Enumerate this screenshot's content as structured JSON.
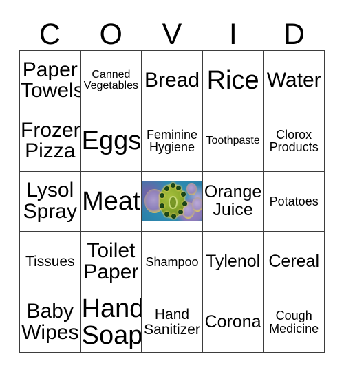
{
  "card": {
    "header_letters": [
      "C",
      "O",
      "V",
      "I",
      "D"
    ],
    "grid": {
      "rows": [
        [
          {
            "label": "Paper Towels",
            "size": "lg"
          },
          {
            "label": "Canned Vegetables",
            "size": "xxs"
          },
          {
            "label": "Bread",
            "size": "lg"
          },
          {
            "label": "Rice",
            "size": "xl"
          },
          {
            "label": "Water",
            "size": "lg"
          }
        ],
        [
          {
            "label": "Frozen Pizza",
            "size": "lg"
          },
          {
            "label": "Eggs",
            "size": "xl"
          },
          {
            "label": "Feminine Hygiene",
            "size": "xs"
          },
          {
            "label": "Toothpaste",
            "size": "xxs"
          },
          {
            "label": "Clorox Products",
            "size": "xs"
          }
        ],
        [
          {
            "label": "Lysol Spray",
            "size": "lg"
          },
          {
            "label": "Meat",
            "size": "xl"
          },
          {
            "label": "",
            "size": "md",
            "image": "coronavirus-microscopy-image"
          },
          {
            "label": "Orange Juice",
            "size": "md"
          },
          {
            "label": "Potatoes",
            "size": "xs"
          }
        ],
        [
          {
            "label": "Tissues",
            "size": "sm"
          },
          {
            "label": "Toilet Paper",
            "size": "lg"
          },
          {
            "label": "Shampoo",
            "size": "xs"
          },
          {
            "label": "Tylenol",
            "size": "md"
          },
          {
            "label": "Cereal",
            "size": "md"
          }
        ],
        [
          {
            "label": "Baby Wipes",
            "size": "lg"
          },
          {
            "label": "Hand Soap",
            "size": "xl"
          },
          {
            "label": "Hand Sanitizer",
            "size": "sm"
          },
          {
            "label": "Corona",
            "size": "md"
          },
          {
            "label": "Cough Medicine",
            "size": "xs"
          }
        ]
      ]
    },
    "colors": {
      "background": "#ffffff",
      "text": "#000000",
      "grid_line": "#3d3d3d",
      "virus_image_background": "#2f8fb4",
      "virus_particle": "#8fae2f"
    }
  }
}
